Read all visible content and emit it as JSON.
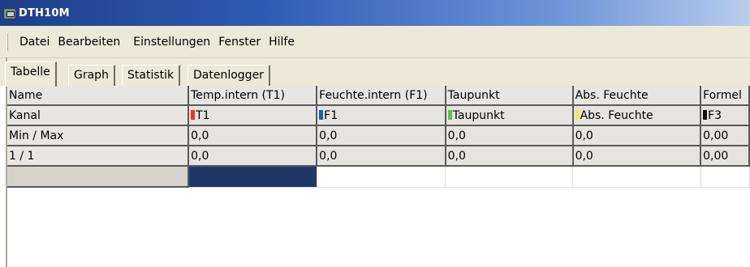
{
  "window": {
    "title": "DTH10M"
  },
  "menu": [
    "Datei",
    "Bearbeiten",
    "Einstellungen",
    "Fenster",
    "Hilfe"
  ],
  "tabs": [
    {
      "label": "Tabelle",
      "active": true
    },
    {
      "label": "Graph",
      "active": false
    },
    {
      "label": "Statistik",
      "active": false
    },
    {
      "label": "Datenlogger",
      "active": false
    }
  ],
  "table": {
    "headers": [
      "Name",
      "Temp.intern (T1)",
      "Feuchte.intern (F1)",
      "Taupunkt",
      "Abs. Feuchte",
      "Formel"
    ],
    "channel_row": {
      "label": "Kanal",
      "channels": [
        {
          "name": "T1",
          "color": "#e8312c"
        },
        {
          "name": "F1",
          "color": "#2857b8"
        },
        {
          "name": "Taupunkt",
          "color": "#5fc24a"
        },
        {
          "name": "Abs. Feuchte",
          "color": "#eee85a"
        },
        {
          "name": "F3",
          "color": "#111111"
        }
      ]
    },
    "rows": [
      {
        "label": "Min / Max",
        "values": [
          "0,0",
          "0,0",
          "0,0",
          "0,0",
          "0,00"
        ]
      },
      {
        "label": "1 / 1",
        "values": [
          "0,0",
          "0,0",
          "0,0",
          "0,0",
          "0,00"
        ]
      }
    ]
  }
}
